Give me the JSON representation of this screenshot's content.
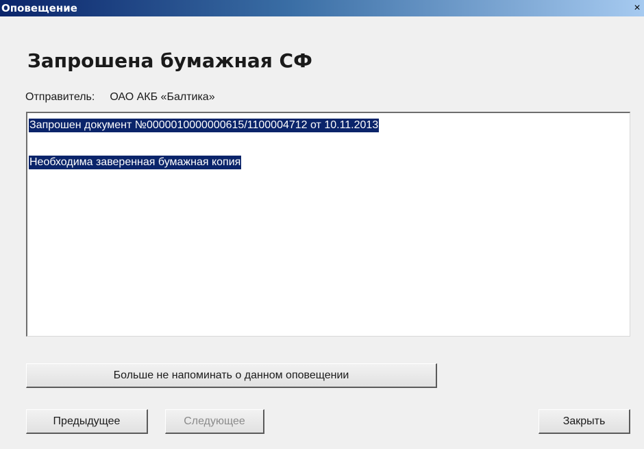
{
  "window": {
    "title": "Оповещение",
    "close_glyph": "×"
  },
  "notification": {
    "heading": "Запрошена бумажная СФ",
    "sender_label": "Отправитель:",
    "sender_value": "ОАО АКБ «Балтика»",
    "message_lines": [
      "Запрошен документ №0000010000000615/1100004712 от 10.11.2013",
      "Необходима заверенная бумажная копия"
    ]
  },
  "buttons": {
    "dont_remind": "Больше не напоминать о данном оповещении",
    "previous": "Предыдущее",
    "next": "Следующее",
    "close": "Закрыть"
  },
  "colors": {
    "selection_bg": "#0a246a",
    "titlebar_start": "#0a246a",
    "titlebar_end": "#a6caf0"
  }
}
